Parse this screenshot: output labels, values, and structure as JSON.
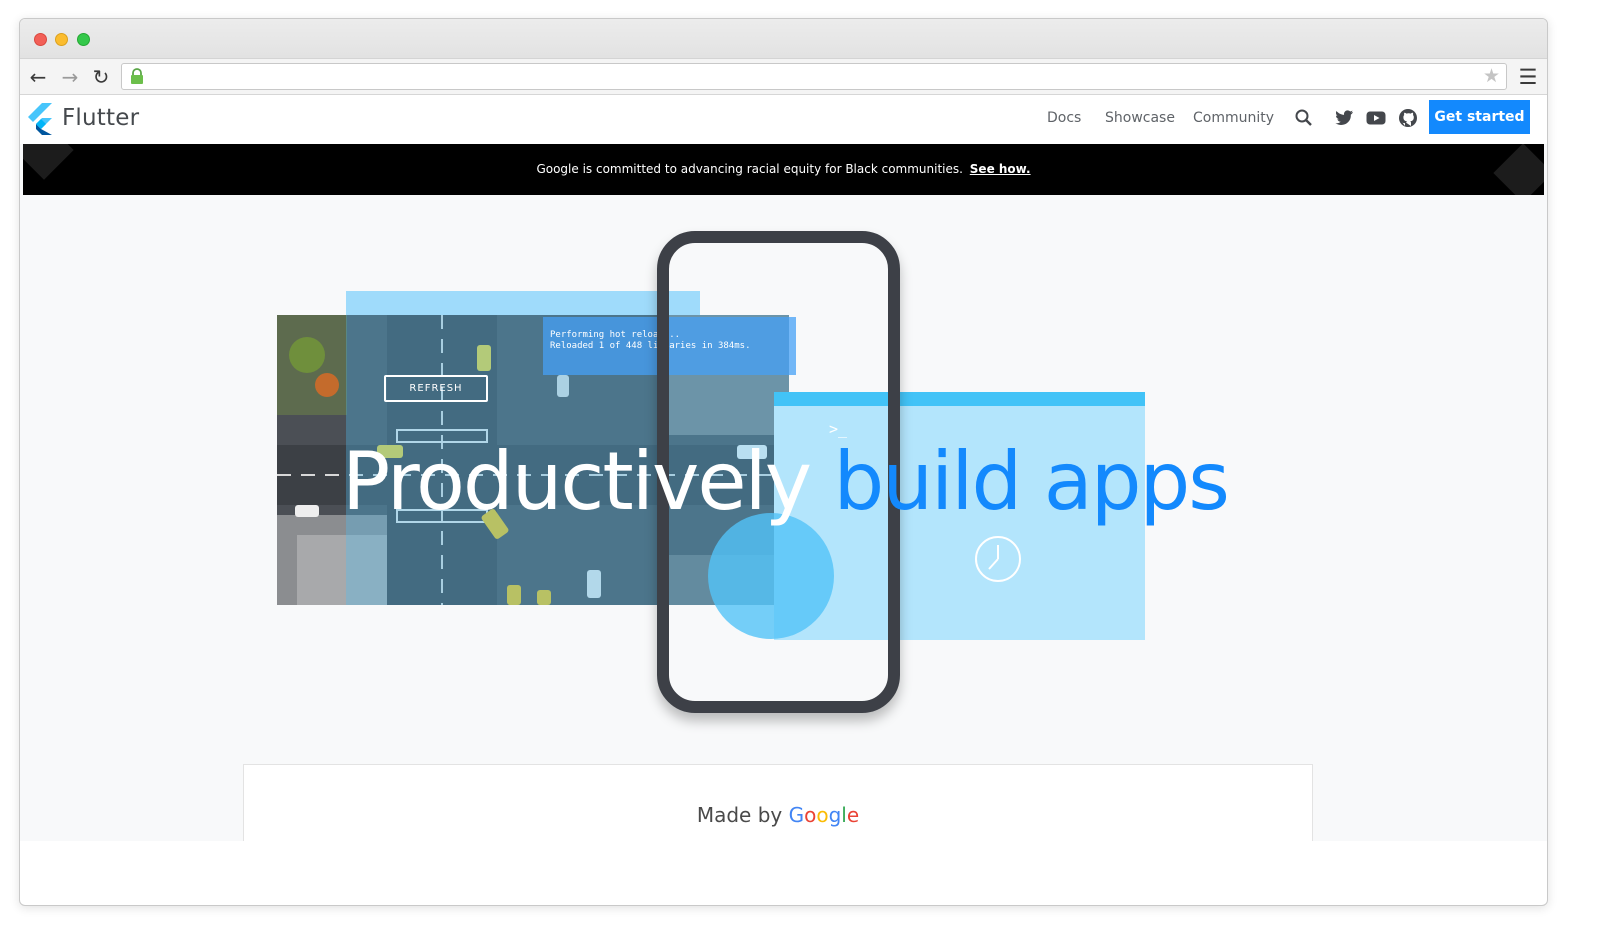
{
  "browser": {
    "address": "",
    "icons": [
      "back-icon",
      "forward-icon",
      "reload-icon",
      "lock-icon",
      "star-icon",
      "menu-icon"
    ]
  },
  "site": {
    "brand": "Flutter",
    "nav": {
      "docs": "Docs",
      "showcase": "Showcase",
      "community": "Community",
      "cta": "Get started"
    },
    "banner": {
      "text": "Google is committed to advancing racial equity for Black communities.",
      "link": "See how."
    },
    "hero": {
      "headline_1": "Productively",
      "headline_2": "build apps",
      "terminal_line1": "Performing hot reload...",
      "terminal_line2": "Reloaded 1 of 448 libraries in 384ms.",
      "refresh": "REFRESH",
      "prompt": ">_"
    },
    "footer": {
      "made_by": "Made by",
      "google": [
        "G",
        "o",
        "o",
        "g",
        "l",
        "e"
      ]
    }
  },
  "colors": {
    "accent": "#1389fd",
    "banner": "#000000",
    "panel": "#b3e5fc",
    "phone": "#3d4047"
  }
}
